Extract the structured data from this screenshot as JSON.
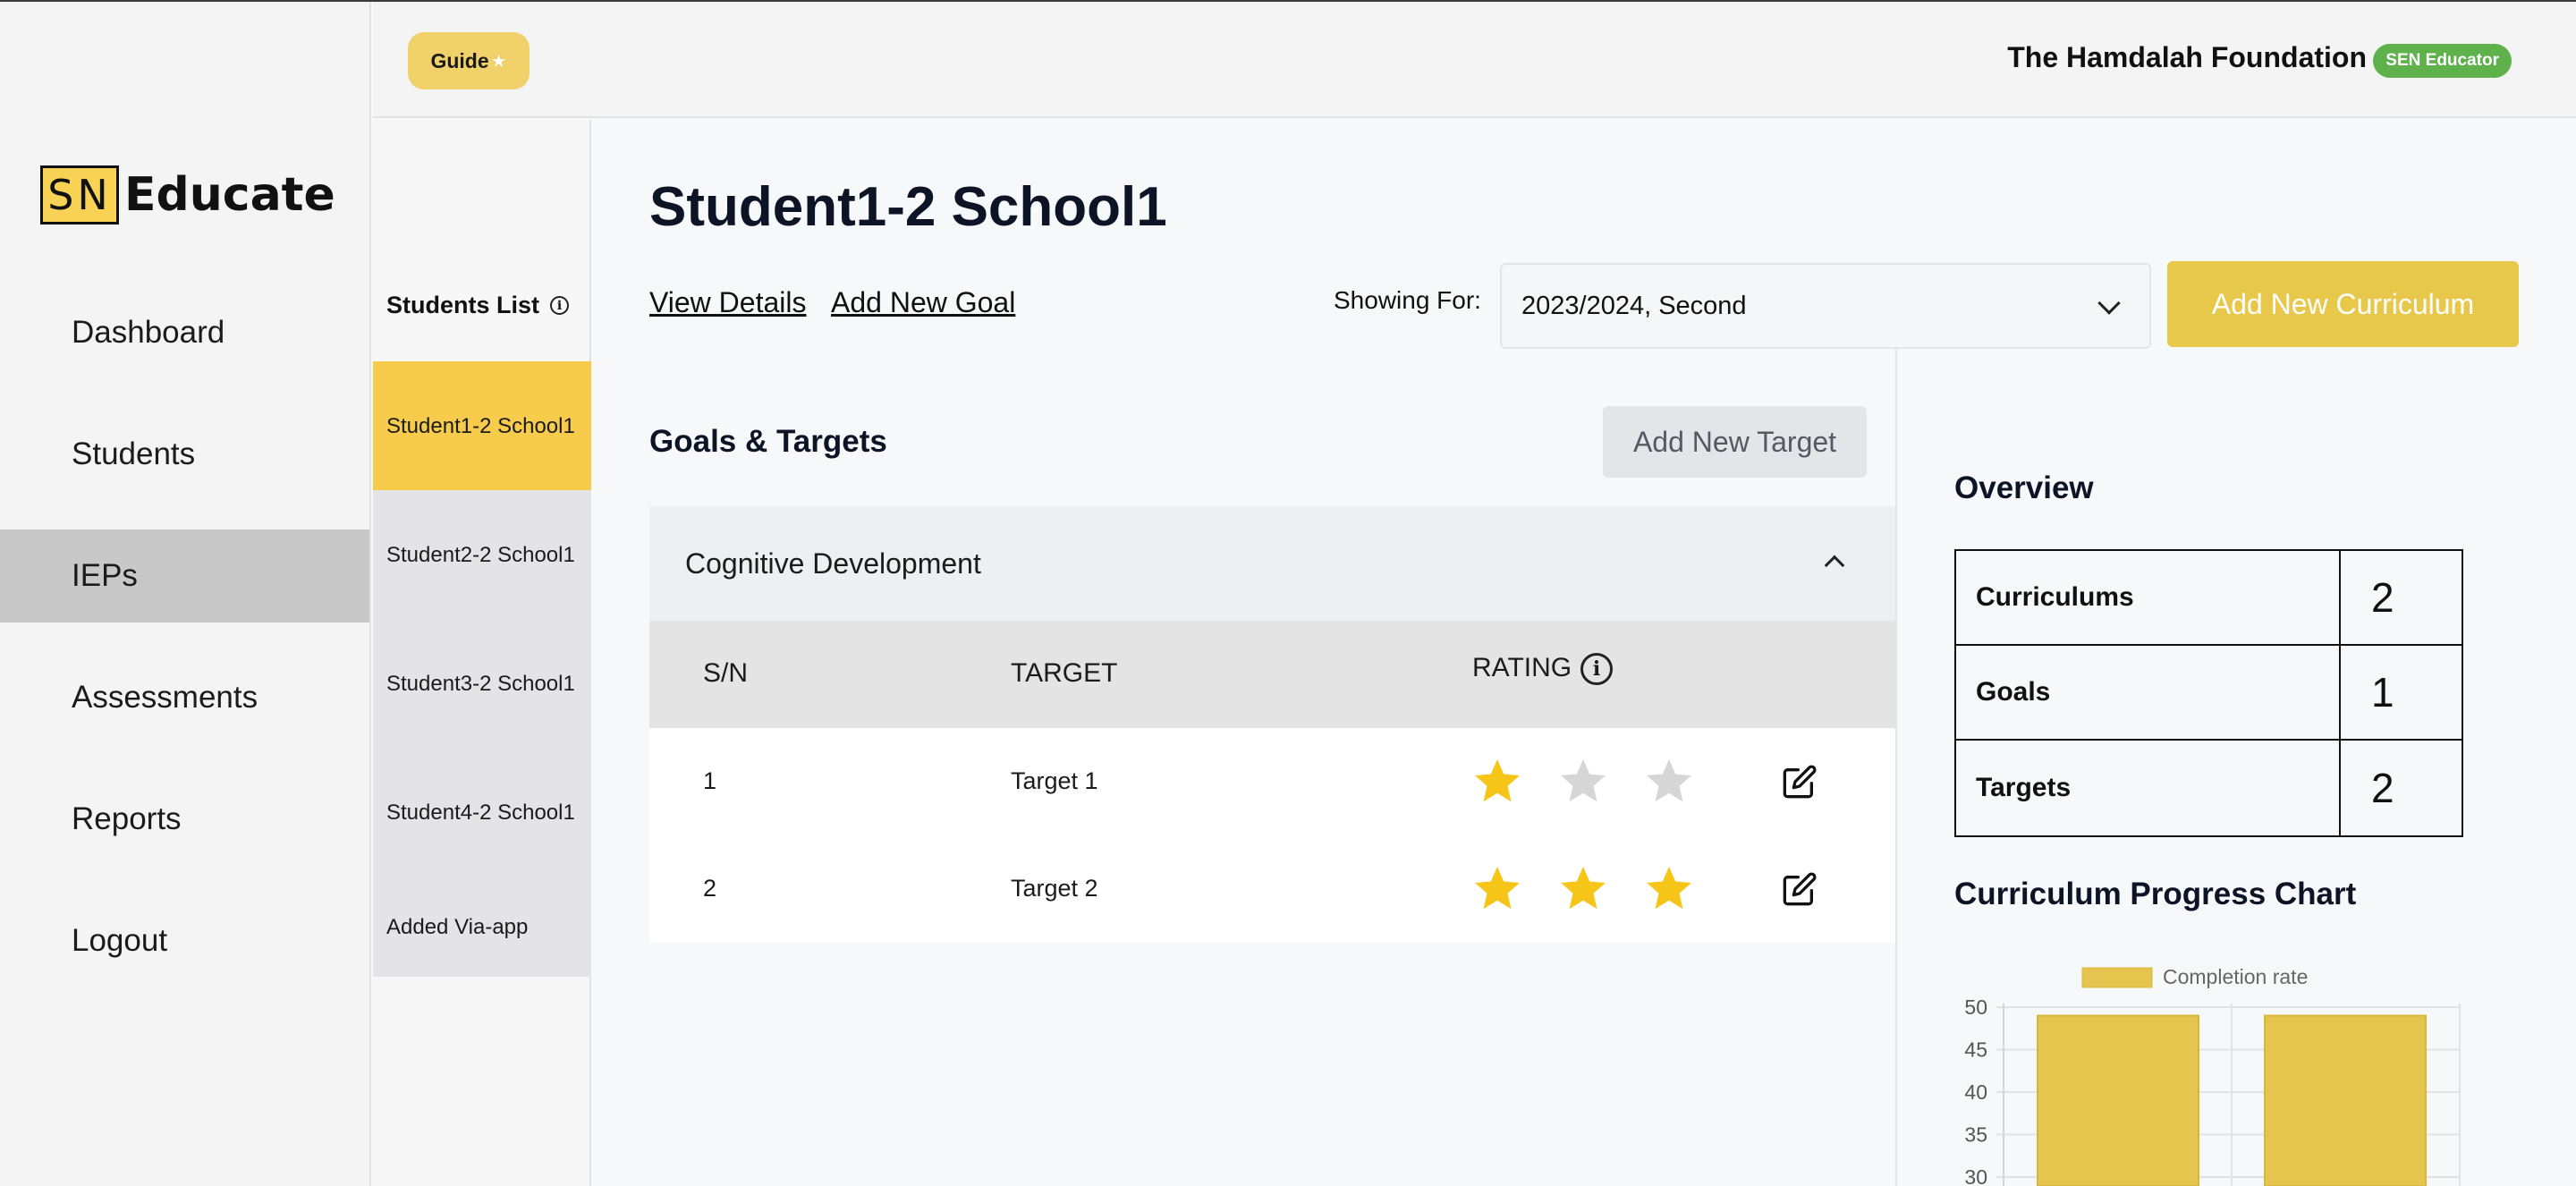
{
  "sidebar": {
    "logo_sn": "SN",
    "logo_text": "Educate",
    "items": [
      {
        "label": "Dashboard"
      },
      {
        "label": "Students"
      },
      {
        "label": "IEPs",
        "active": true
      },
      {
        "label": "Assessments"
      },
      {
        "label": "Reports"
      },
      {
        "label": "Logout"
      }
    ]
  },
  "header": {
    "guide_label": "Guide",
    "guide_icon": "star-icon",
    "org_name": "The Hamdalah Foundation",
    "role_badge": "SEN Educator",
    "role_color": "#5fb14b"
  },
  "students_list": {
    "title": "Students List",
    "info_glyph": "i",
    "items": [
      {
        "label": "Student1-2 School1",
        "active": true
      },
      {
        "label": "Student2-2 School1"
      },
      {
        "label": "Student3-2 School1"
      },
      {
        "label": "Student4-2 School1"
      },
      {
        "label": "Added Via-app"
      }
    ]
  },
  "main": {
    "title": "Student1-2 School1",
    "view_details": "View Details",
    "add_new_goal": "Add New Goal",
    "showing_for_label": "Showing For:",
    "showing_for_value": "2023/2024, Second",
    "add_curriculum": "Add New Curriculum",
    "goals_title": "Goals & Targets",
    "add_target": "Add New Target",
    "accordion_title": "Cognitive Development",
    "columns": {
      "sn": "S/N",
      "target": "TARGET",
      "rating": "RATING"
    },
    "rows": [
      {
        "sn": "1",
        "target": "Target 1",
        "rating": 1,
        "max": 3
      },
      {
        "sn": "2",
        "target": "Target 2",
        "rating": 3,
        "max": 3
      }
    ]
  },
  "overview": {
    "title": "Overview",
    "rows": [
      {
        "label": "Curriculums",
        "value": "2"
      },
      {
        "label": "Goals",
        "value": "1"
      },
      {
        "label": "Targets",
        "value": "2"
      }
    ]
  },
  "colors": {
    "accent": "#f7cc4c",
    "button_yellow": "#e8c84a",
    "star_on": "#f5c518",
    "star_off": "#d6d6d6",
    "bar": "#e6c54f"
  },
  "chart_data": {
    "type": "bar",
    "title": "Curriculum Progress Chart",
    "legend": [
      "Completion rate"
    ],
    "legend_position": "top",
    "series": [
      {
        "name": "Completion rate",
        "values": [
          49,
          49
        ]
      }
    ],
    "yticks": [
      50,
      45,
      40,
      35,
      30
    ],
    "ylim_visible": [
      30,
      50
    ],
    "grid": true
  }
}
